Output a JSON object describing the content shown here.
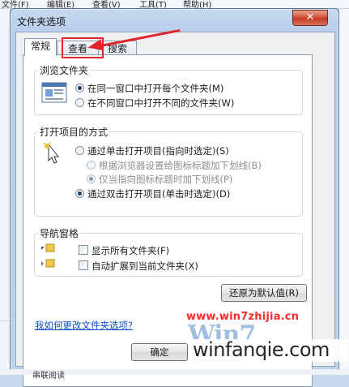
{
  "menubar": {
    "items": [
      "文件(F)",
      "编辑(E)",
      "查看(V)",
      "工具(T)",
      "帮助(H)"
    ]
  },
  "dialog": {
    "title": "文件夹选项",
    "close_glyph": "✕",
    "tabs": [
      {
        "label": "常规"
      },
      {
        "label": "查看"
      },
      {
        "label": "搜索"
      }
    ],
    "browse_group": {
      "label": "浏览文件夹",
      "options": [
        {
          "label": "在同一窗口中打开每个文件夹(M)",
          "checked": true
        },
        {
          "label": "在不同窗口中打开不同的文件夹(W)",
          "checked": false
        }
      ]
    },
    "open_group": {
      "label": "打开项目的方式",
      "options": [
        {
          "label": "通过单击打开项目(指向时选定)(S)",
          "checked": false
        },
        {
          "label": "根据浏览器设置给图标标题加下划线(B)",
          "checked": false,
          "disabled": true
        },
        {
          "label": "仅当指向图标标题时加下划线(P)",
          "checked": true,
          "disabled": true
        },
        {
          "label": "通过双击打开项目(单击时选定)(D)",
          "checked": true
        }
      ]
    },
    "nav_group": {
      "label": "导航窗格",
      "options": [
        {
          "label": "显示所有文件夹(F)",
          "checked": false
        },
        {
          "label": "自动扩展到当前文件夹(X)",
          "checked": false
        }
      ]
    },
    "restore_label": "还原为默认值(R)",
    "help_link": "我如何更改文件夹选项?",
    "ok_label": "确定"
  },
  "watermark": {
    "site": "www.win7zhijia.cn",
    "logo": "Win7",
    "site2": "winfanqie.com"
  },
  "background": {
    "bottom_text": "串联阅读"
  },
  "colors": {
    "accent_red": "#e2242c",
    "link_blue": "#0b50c8",
    "close_red": "#c43a22"
  }
}
